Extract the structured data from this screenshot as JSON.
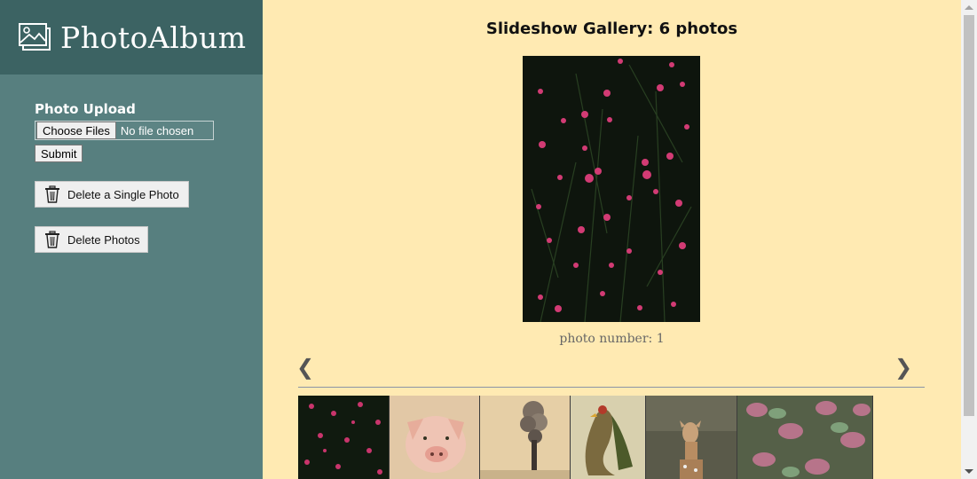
{
  "brand": {
    "name": "PhotoAlbum"
  },
  "upload": {
    "title": "Photo Upload",
    "choose_label": "Choose Files",
    "file_status": "No file chosen",
    "submit_label": "Submit"
  },
  "actions": {
    "delete_single_label": "Delete a Single Photo",
    "delete_all_label": "Delete Photos"
  },
  "gallery": {
    "title": "Slideshow Gallery: 6 photos",
    "caption": "photo number: 1",
    "prev_glyph": "❮",
    "next_glyph": "❯",
    "thumbnails": [
      "pink-flowers",
      "pig",
      "smoke",
      "rooster",
      "deer",
      "leaves"
    ]
  },
  "colors": {
    "sidebar": "#577f7f",
    "brand_bar": "#3c6363",
    "main_bg": "#ffeab2"
  }
}
